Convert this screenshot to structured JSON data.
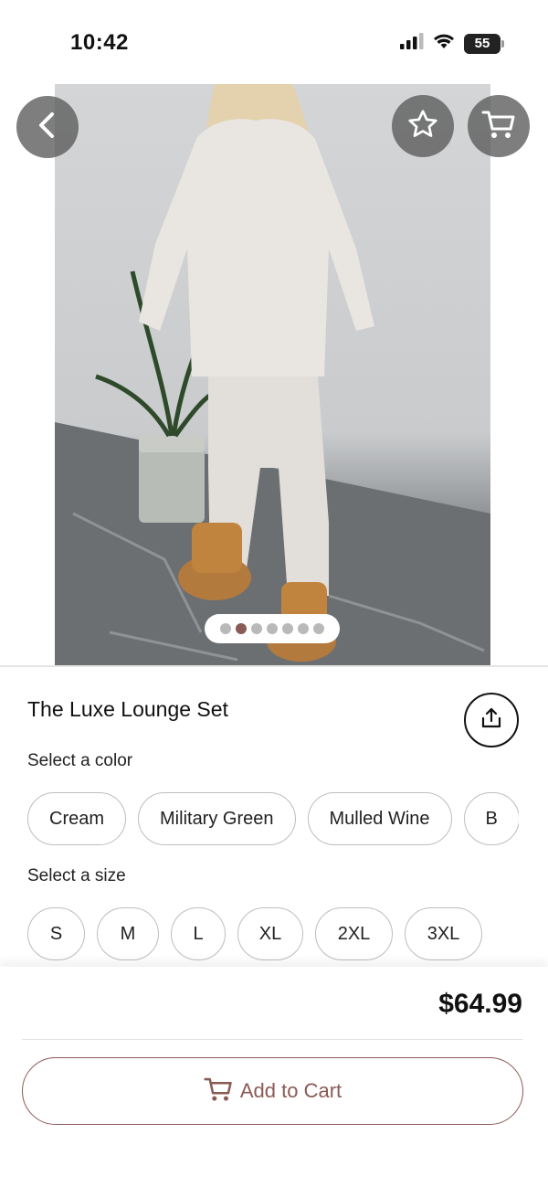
{
  "status_bar": {
    "time": "10:42",
    "battery": "55",
    "icons": [
      "cellular-signal-icon",
      "wifi-icon",
      "battery-icon"
    ]
  },
  "header": {
    "icons": [
      "back-arrow-icon",
      "star-icon",
      "cart-icon"
    ]
  },
  "gallery": {
    "image_count": 7,
    "active_index": 1
  },
  "product": {
    "title": "The Luxe Lounge Set",
    "share_icon": "share-icon"
  },
  "color_selector": {
    "label": "Select a color",
    "options": [
      "Cream",
      "Military Green",
      "Mulled Wine",
      "B"
    ]
  },
  "size_selector": {
    "label": "Select a size",
    "options": [
      "S",
      "M",
      "L",
      "XL",
      "2XL",
      "3XL"
    ]
  },
  "purchase": {
    "price": "$64.99",
    "add_to_cart_label": "Add to Cart",
    "add_to_cart_icon": "cart-icon"
  },
  "colors": {
    "accent": "#8a5a55",
    "chip_border": "#bdbdbd",
    "overlay_button": "#5a5a5a"
  }
}
